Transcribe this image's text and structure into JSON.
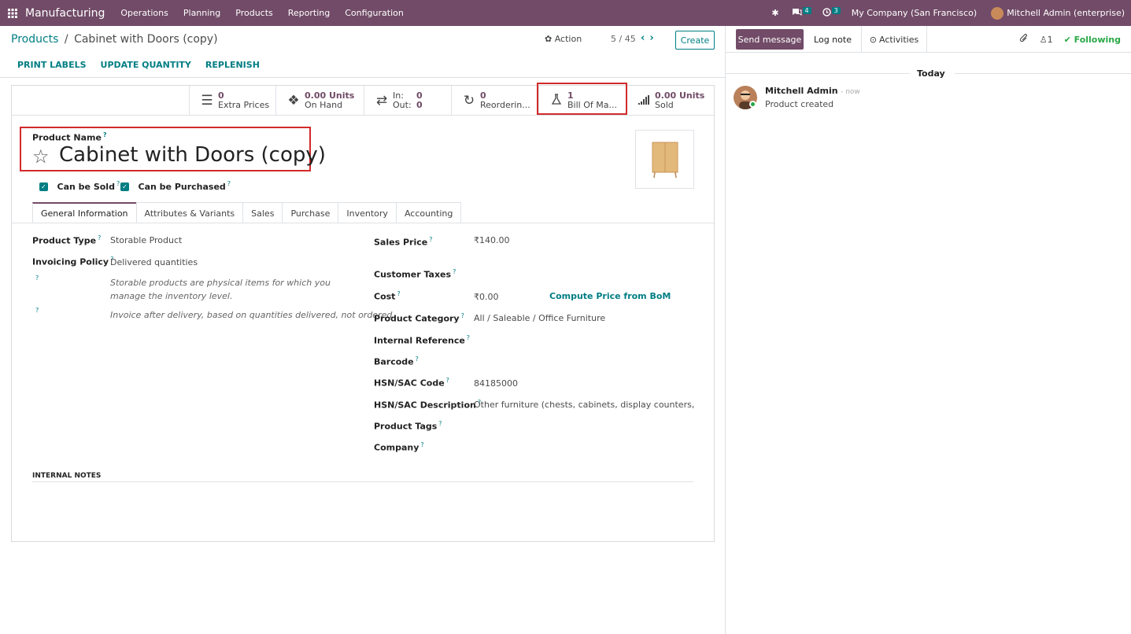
{
  "topbar": {
    "app_name": "Manufacturing",
    "menu": [
      "Operations",
      "Planning",
      "Products",
      "Reporting",
      "Configuration"
    ],
    "messages_count": "4",
    "activities_count": "3",
    "company": "My Company (San Francisco)",
    "user": "Mitchell Admin (enterprise)"
  },
  "breadcrumb": {
    "parent": "Products",
    "separator": "/",
    "current": "Cabinet with Doors (copy)"
  },
  "toolbar": {
    "action_label": "Action",
    "pager": "5 / 45",
    "create_label": "Create"
  },
  "header_buttons": [
    "PRINT LABELS",
    "UPDATE QUANTITY",
    "REPLENISH"
  ],
  "smart_buttons": {
    "extra_prices": {
      "value": "0",
      "label": "Extra Prices"
    },
    "on_hand": {
      "value": "0.00 Units",
      "label": "On Hand"
    },
    "in_out": {
      "in_label": "In:",
      "in_value": "0",
      "out_label": "Out:",
      "out_value": "0"
    },
    "reordering": {
      "value": "0",
      "label": "Reorderin..."
    },
    "bom": {
      "value": "1",
      "label": "Bill Of Ma..."
    },
    "sold": {
      "value": "0.00 Units",
      "label": "Sold"
    }
  },
  "product": {
    "name_label": "Product Name",
    "name": "Cabinet with Doors (copy)",
    "can_be_sold": "Can be Sold",
    "can_be_purchased": "Can be Purchased"
  },
  "tabs": [
    "General Information",
    "Attributes & Variants",
    "Sales",
    "Purchase",
    "Inventory",
    "Accounting"
  ],
  "general": {
    "product_type_label": "Product Type",
    "product_type": "Storable Product",
    "invoicing_policy_label": "Invoicing Policy",
    "invoicing_policy": "Delivered quantities",
    "help1": "Storable products are physical items for which you manage the inventory level.",
    "help2": "Invoice after delivery, based on quantities delivered, not ordered.",
    "sales_price_label": "Sales Price",
    "sales_price": "₹140.00",
    "customer_taxes_label": "Customer Taxes",
    "cost_label": "Cost",
    "cost": "₹0.00",
    "compute_price": "Compute Price from BoM",
    "product_category_label": "Product Category",
    "product_category": "All / Saleable / Office Furniture",
    "internal_reference_label": "Internal Reference",
    "barcode_label": "Barcode",
    "hsn_code_label": "HSN/SAC Code",
    "hsn_code": "84185000",
    "hsn_desc_label": "HSN/SAC Description",
    "hsn_desc": "Other furniture (chests, cabinets, display counters, show-c",
    "product_tags_label": "Product Tags",
    "company_label": "Company",
    "internal_notes_label": "INTERNAL NOTES"
  },
  "chatter": {
    "send_message": "Send message",
    "log_note": "Log note",
    "activities": "Activities",
    "followers_count": "1",
    "following": "Following",
    "today": "Today",
    "author": "Mitchell Admin",
    "time": "- now",
    "message": "Product created"
  },
  "colors": {
    "brand": "#714b67",
    "accent": "#017e84",
    "highlight": "#d22a2a"
  }
}
